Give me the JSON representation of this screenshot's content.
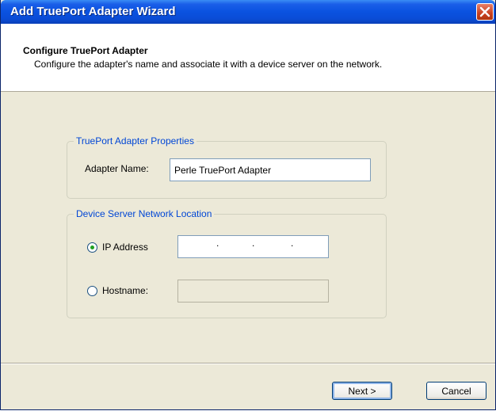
{
  "window": {
    "title": "Add TruePort Adapter Wizard"
  },
  "header": {
    "title": "Configure TruePort Adapter",
    "description": "Configure the adapter's name and associate it with a device server on the network."
  },
  "adapter_properties": {
    "legend": "TruePort Adapter Properties",
    "name_label": "Adapter Name:",
    "name_value": "Perle TruePort Adapter"
  },
  "network_location": {
    "legend": "Device Server Network Location",
    "ip_label": "IP Address",
    "ip_selected": true,
    "ip_value": ".   .   .",
    "hostname_label": "Hostname:",
    "hostname_selected": false,
    "hostname_value": ""
  },
  "buttons": {
    "next_label": "Next >",
    "cancel_label": "Cancel"
  },
  "icons": {
    "close": "close-icon"
  }
}
